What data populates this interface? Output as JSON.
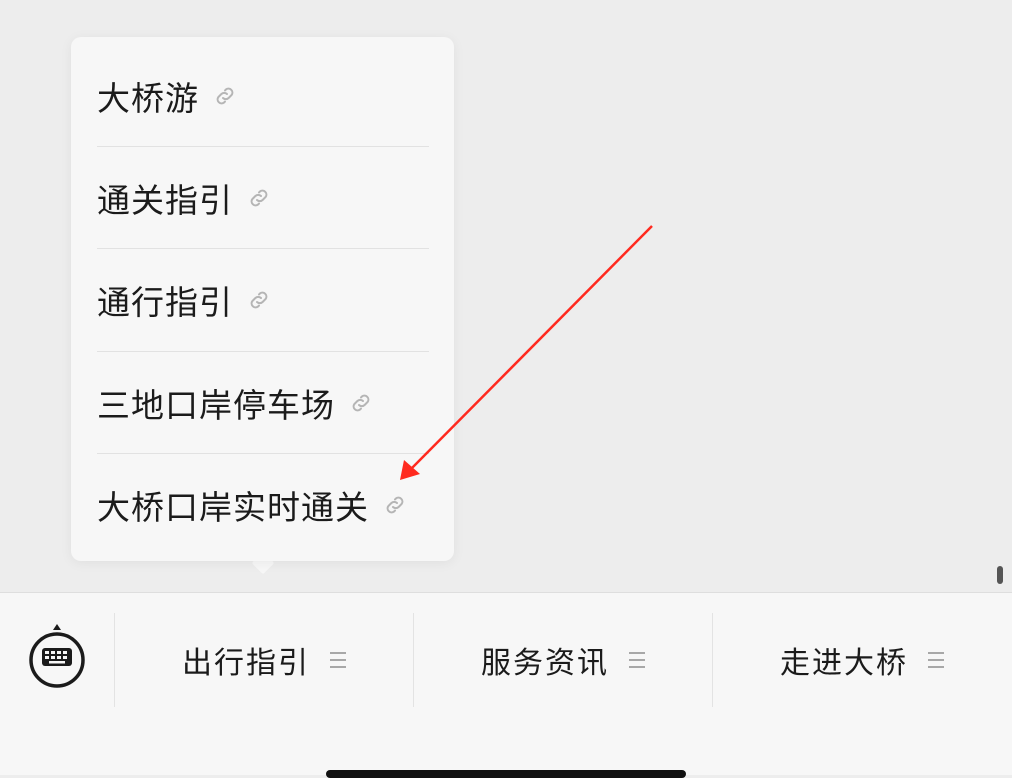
{
  "submenu": {
    "items": [
      {
        "label": "大桥游",
        "icon": "link-icon"
      },
      {
        "label": "通关指引",
        "icon": "link-icon"
      },
      {
        "label": "通行指引",
        "icon": "link-icon"
      },
      {
        "label": "三地口岸停车场",
        "icon": "link-icon"
      },
      {
        "label": "大桥口岸实时通关",
        "icon": "link-icon"
      }
    ]
  },
  "menu_bar": {
    "keyboard_icon": "keyboard-icon",
    "tabs": [
      {
        "label": "出行指引",
        "icon": "hamburger-icon"
      },
      {
        "label": "服务资讯",
        "icon": "hamburger-icon"
      },
      {
        "label": "走进大桥",
        "icon": "hamburger-icon"
      }
    ]
  },
  "colors": {
    "background": "#ededed",
    "popup": "#f7f7f7",
    "annotation_arrow": "#ff2a1f",
    "text": "#1b1b1b",
    "icon_gray": "#a8a8a8"
  }
}
